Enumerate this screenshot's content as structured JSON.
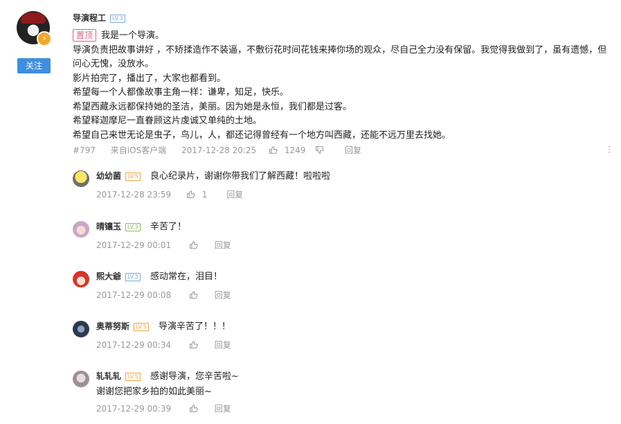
{
  "main_comment": {
    "username": "导演程工",
    "level_badge": "LV.3",
    "follow_label": "关注",
    "pin_tag": "置顶",
    "paragraphs": [
      "我是一个导演。",
      "导演负责把故事讲好 ，不矫揉造作不装逼，不敷衍花时间花钱来捧你场的观众，尽自己全力没有保留。我觉得我做到了，虽有遗憾，但问心无愧，没放水。",
      "影片拍完了，播出了，大家也都看到。",
      "希望每一个人都像故事主角一样：谦卑，知足，快乐。",
      "希望西藏永远都保持她的圣洁，美丽。因为她是永恒，我们都是过客。",
      "希望释迦摩尼一直眷顾这片虔诚又单纯的土地。",
      "希望自己来世无论是虫子，鸟儿，人，都还记得曾经有一个地方叫西藏，还能不远万里去找她。"
    ],
    "floor": "#797",
    "source": "来自iOS客户端",
    "time": "2017-12-28 20:25",
    "likes": "1249",
    "reply_label": "回复"
  },
  "replies": [
    {
      "name": "幼幼菌",
      "level_badge": "LV.5",
      "text": "良心纪录片，谢谢你带我们了解西藏！啦啦啦",
      "time": "2017-12-28 23:59",
      "likes": "1",
      "reply_label": "回复"
    },
    {
      "name": "晴镶玉",
      "level_badge": "LV.3",
      "text": "辛苦了！",
      "time": "2017-12-29 00:01",
      "likes": "",
      "reply_label": "回复"
    },
    {
      "name": "熙大爺",
      "level_badge": "LV.3",
      "text": "感动常在，泪目！",
      "time": "2017-12-29 00:08",
      "likes": "",
      "reply_label": "回复"
    },
    {
      "name": "奥蒂努斯",
      "level_badge": "LV.5",
      "text": "导演辛苦了！！！",
      "time": "2017-12-29 00:34",
      "likes": "",
      "reply_label": "回复"
    },
    {
      "name": "轧轧轧",
      "level_badge": "LV.5",
      "text": "感谢导演，您辛苦啦~",
      "text2": "谢谢您把家乡拍的如此美丽~",
      "time": "2017-12-29 00:39",
      "likes": "",
      "reply_label": "回复"
    }
  ],
  "colors": {
    "follow_button": "#3f8fe0",
    "pin_tag": "#e35d7f",
    "meta_text": "#999999"
  }
}
